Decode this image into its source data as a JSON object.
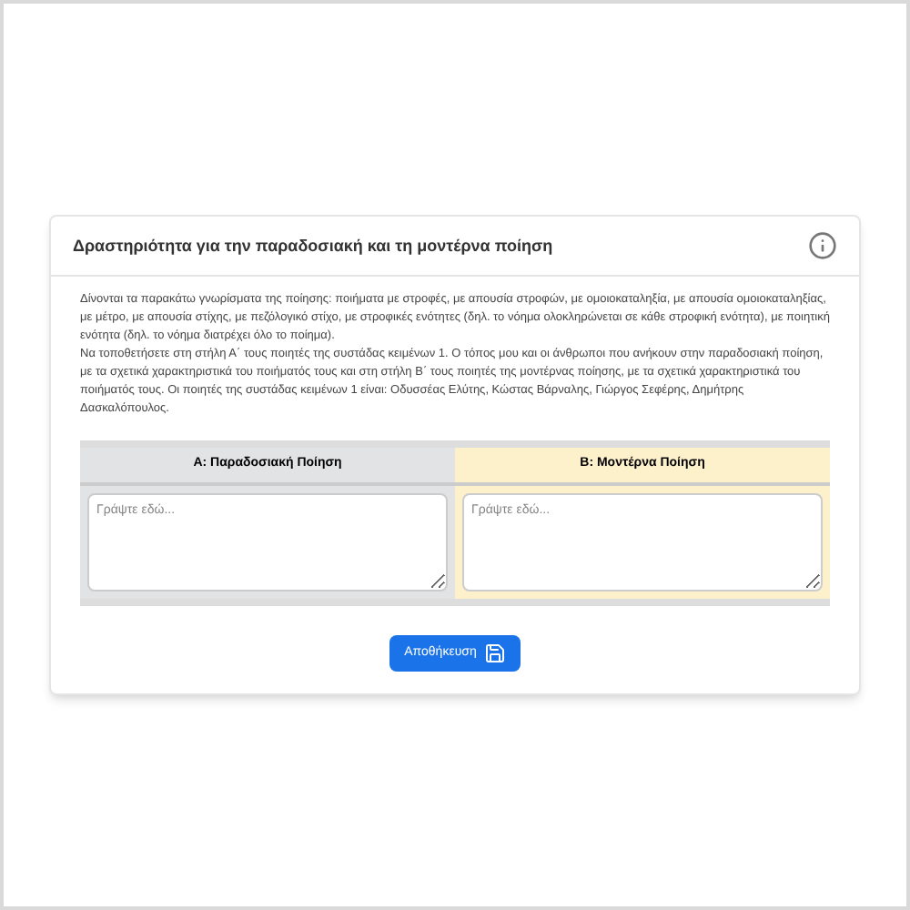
{
  "title": "Δραστηριότητα για την παραδοσιακή και τη μοντέρνα ποίηση",
  "instructions": [
    "Δίνονται τα παρακάτω γνωρίσματα της ποίησης: ποιήματα με στροφές, με απουσία στροφών, με ομοιοκαταληξία, με απουσία ομοιοκαταληξίας, με μέτρο, με απουσία στίχης, με πεζόλογικό στίχο, με στροφικές ενότητες (δηλ. το νόημα ολοκληρώνεται σε κάθε στροφική ενότητα), με ποιητική ενότητα (δηλ. το νόημα διατρέχει όλο το ποίημα).",
    "Να τοποθετήσετε στη στήλη Α΄ τους ποιητές της συστάδας κειμένων 1. Ο τόπος μου και οι άνθρωποι που ανήκουν στην παραδοσιακή ποίηση, με τα σχετικά χαρακτηριστικά του ποιήματός τους και στη στήλη Β΄ τους ποιητές της μοντέρνας ποίησης, με τα σχετικά χαρακτηριστικά του ποιήματός τους. Οι ποιητές της συστάδας κειμένων 1 είναι: Οδυσσέας Ελύτης, Κώστας Βάρναλης, Γιώργος Σεφέρης, Δημήτρης Δασκαλόπουλος."
  ],
  "columns": [
    {
      "heading": "Α: Παραδοσιακή Ποίηση",
      "color": "#e2e3e5",
      "placeholder": "Γράψτε εδώ..."
    },
    {
      "heading": "Β: Μοντέρνα Ποίηση",
      "color": "#fdf1cc",
      "placeholder": "Γράψτε εδώ..."
    }
  ],
  "save_button": "Αποθήκευση"
}
